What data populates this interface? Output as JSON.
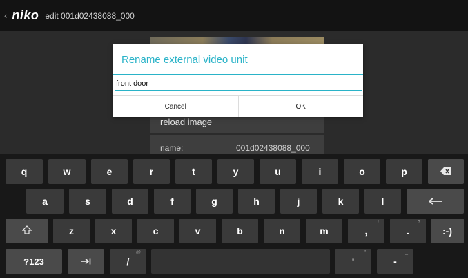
{
  "topbar": {
    "back_glyph": "‹",
    "logo": "niko",
    "breadcrumb": "edit 001d02438088_000"
  },
  "background": {
    "reload_label": "reload image",
    "name_label": "name:",
    "name_value": "001d02438088_000"
  },
  "dialog": {
    "title": "Rename external video unit",
    "input_value": "front door",
    "cancel_label": "Cancel",
    "ok_label": "OK"
  },
  "keyboard": {
    "row1": [
      "q",
      "w",
      "e",
      "r",
      "t",
      "y",
      "u",
      "i",
      "o",
      "p"
    ],
    "row2": [
      "a",
      "s",
      "d",
      "f",
      "g",
      "h",
      "j",
      "k",
      "l"
    ],
    "row3": [
      "z",
      "x",
      "c",
      "v",
      "b",
      "n",
      "m",
      ",",
      "."
    ],
    "row3_hints": [
      "!",
      "?"
    ],
    "smiley": ":-)",
    "symbols": "?123",
    "slash": "/",
    "slash_hint": "@",
    "apostrophe": "'",
    "apostrophe_hint": "\"",
    "dash": "-",
    "dash_hint": "_"
  },
  "colors": {
    "accent": "#2ab3c8",
    "keyboard_bg": "#181818",
    "key_bg": "#3a3a3a"
  }
}
